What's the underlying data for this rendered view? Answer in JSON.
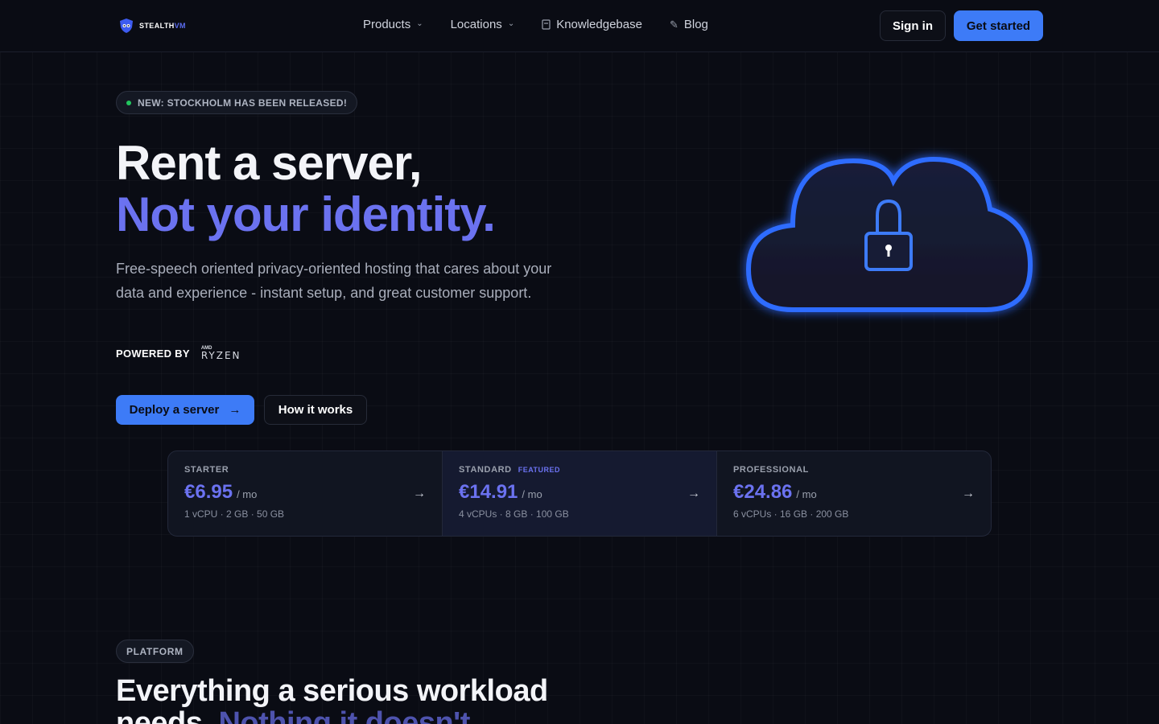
{
  "brand": {
    "name_main": "STEALTH",
    "name_accent": "VM"
  },
  "nav": {
    "items": [
      {
        "label": "Products",
        "has_dropdown": true
      },
      {
        "label": "Locations",
        "has_dropdown": true
      },
      {
        "label": "Knowledgebase",
        "icon": "book-icon"
      },
      {
        "label": "Blog",
        "icon": "pencil-icon"
      }
    ],
    "signin_label": "Sign in",
    "getstarted_label": "Get started"
  },
  "hero": {
    "badge": "NEW: STOCKHOLM HAS BEEN RELEASED!",
    "title_line1": "Rent a server,",
    "title_line2": "Not your identity.",
    "lead": "Free-speech oriented privacy-oriented hosting that cares about your data and experience - instant setup, and great customer support.",
    "powered_label": "POWERED BY",
    "powered_brand_small": "AMD",
    "powered_brand": "RYZEN",
    "deploy_label": "Deploy a server",
    "how_label": "How it works"
  },
  "pricing": {
    "plans": [
      {
        "name": "STARTER",
        "featured_label": "",
        "price": "€6.95",
        "unit": "/ mo",
        "specs": "1 vCPU · 2 GB · 50 GB"
      },
      {
        "name": "STANDARD",
        "featured_label": "FEATURED",
        "price": "€14.91",
        "unit": "/ mo",
        "specs": "4 vCPUs · 8 GB · 100 GB"
      },
      {
        "name": "PROFESSIONAL",
        "featured_label": "",
        "price": "€24.86",
        "unit": "/ mo",
        "specs": "6 vCPUs · 16 GB · 200 GB"
      }
    ]
  },
  "platform": {
    "badge": "PLATFORM",
    "title_line1": "Everything a serious workload",
    "title_line2_a": "needs. ",
    "title_line2_b": "Nothing it doesn't."
  },
  "colors": {
    "background": "#0a0c14",
    "accent": "#3d7bf7",
    "headline_accent": "#6b72f0",
    "status_dot": "#22c55e"
  }
}
